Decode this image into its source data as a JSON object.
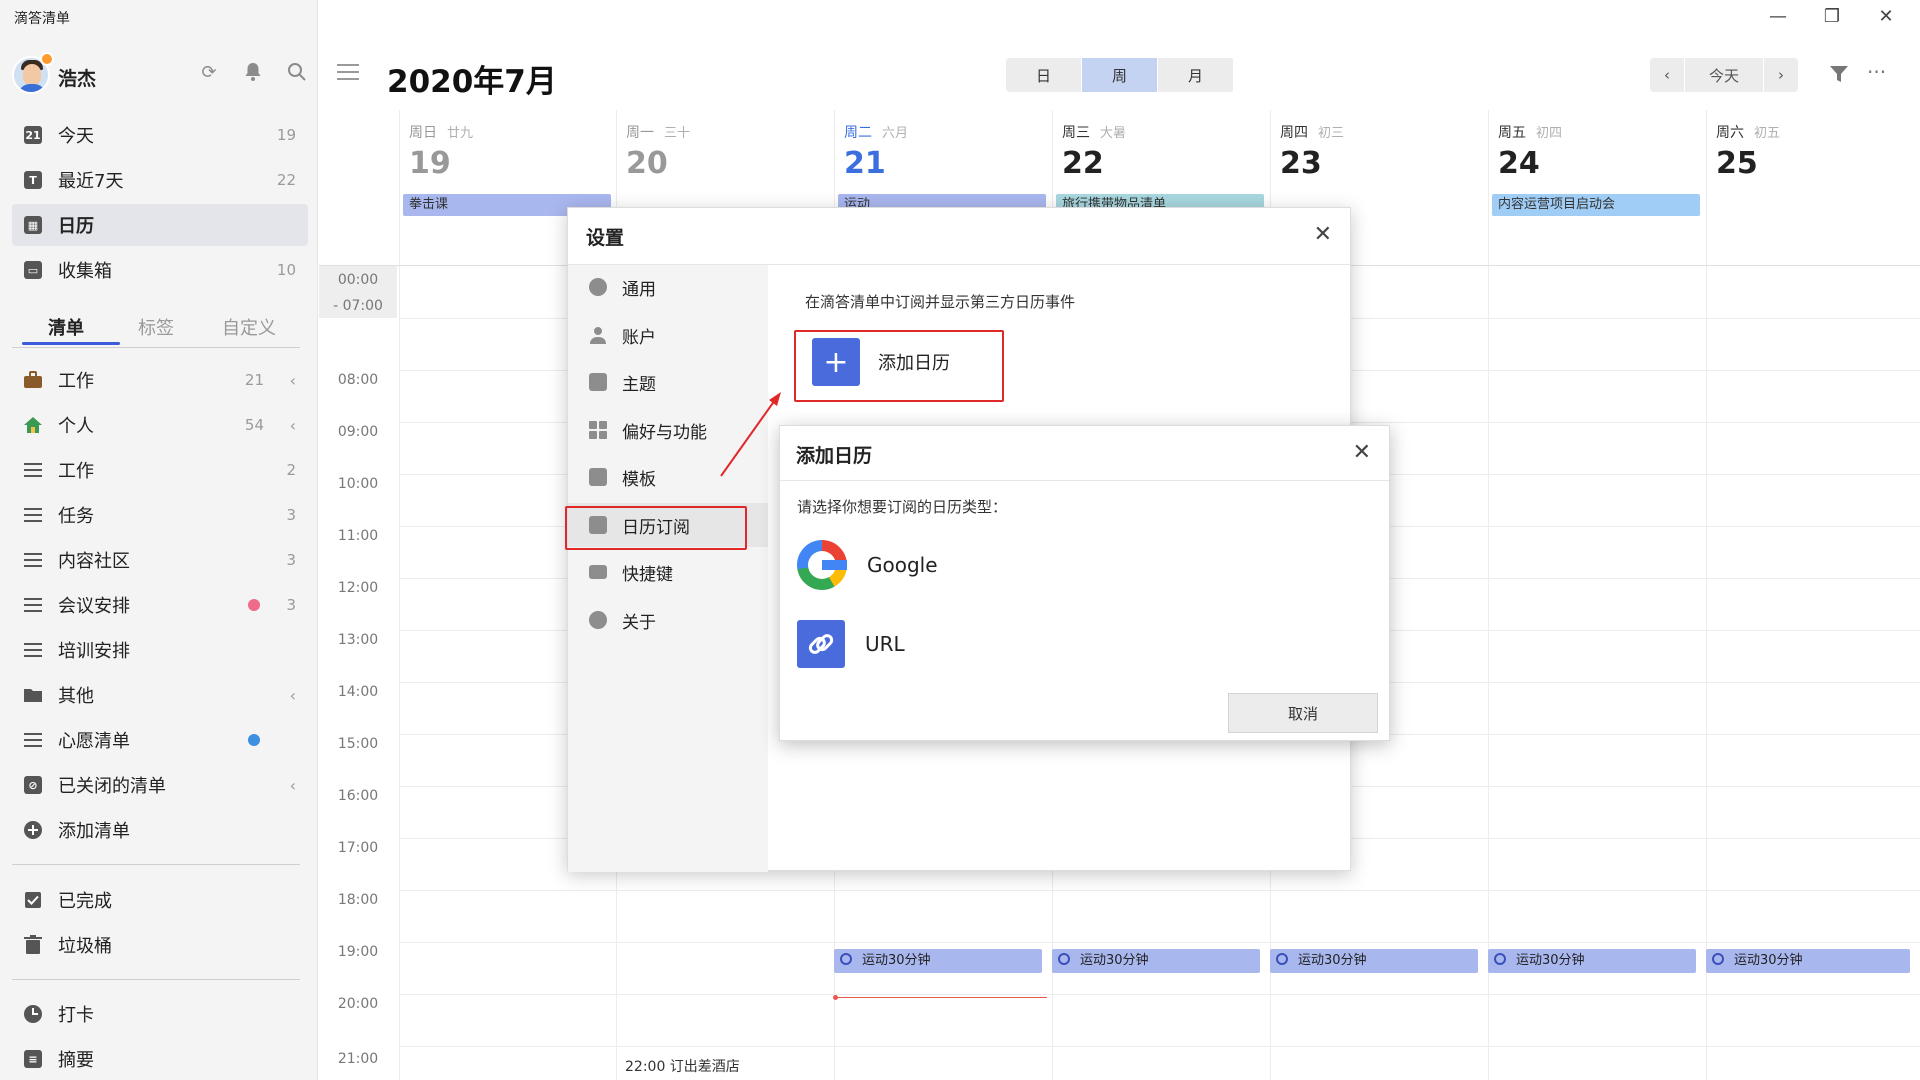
{
  "app": {
    "title": "滴答清单"
  },
  "user": {
    "name": "浩杰"
  },
  "sidebar": {
    "smart_lists": [
      {
        "label": "今天",
        "count": "19",
        "icon": "calendar-21-icon"
      },
      {
        "label": "最近7天",
        "count": "22",
        "icon": "calendar-week-icon"
      },
      {
        "label": "日历",
        "count": "",
        "icon": "calendar-grid-icon"
      },
      {
        "label": "收集箱",
        "count": "10",
        "icon": "inbox-icon"
      }
    ],
    "tabs": [
      "清单",
      "标签",
      "自定义"
    ],
    "lists": [
      {
        "label": "工作",
        "count": "21",
        "icon": "briefcase-icon",
        "chevron": true
      },
      {
        "label": "个人",
        "count": "54",
        "icon": "house-icon",
        "chevron": true
      },
      {
        "label": "工作",
        "count": "2",
        "icon": "list-icon"
      },
      {
        "label": "任务",
        "count": "3",
        "icon": "shared-list-icon"
      },
      {
        "label": "内容社区",
        "count": "3",
        "icon": "shared-list-icon"
      },
      {
        "label": "会议安排",
        "count": "3",
        "icon": "list-icon",
        "dot": "#f06b8a"
      },
      {
        "label": "培训安排",
        "count": "",
        "icon": "list-icon"
      },
      {
        "label": "其他",
        "count": "",
        "icon": "folder-icon",
        "chevron": true
      },
      {
        "label": "心愿清单",
        "count": "",
        "icon": "list-icon",
        "dot": "#3d8fe0"
      },
      {
        "label": "已关闭的清单",
        "count": "",
        "icon": "archive-icon",
        "chevron": true
      },
      {
        "label": "添加清单",
        "count": "",
        "icon": "plus-circle-icon"
      }
    ],
    "bottom": [
      {
        "label": "已完成",
        "icon": "checkbox-icon"
      },
      {
        "label": "垃圾桶",
        "icon": "trash-icon"
      },
      {
        "label": "打卡",
        "icon": "habit-icon"
      },
      {
        "label": "摘要",
        "icon": "summary-icon"
      }
    ]
  },
  "header": {
    "title": "2020年7月",
    "views": [
      "日",
      "周",
      "月"
    ],
    "active_view": "周",
    "today": "今天"
  },
  "days": [
    {
      "week": "周日",
      "lunar": "廿九",
      "num": "19",
      "event": "拳击课",
      "ev_color": "#a9b7ef"
    },
    {
      "week": "周一",
      "lunar": "三十",
      "num": "20",
      "event": "",
      "ev_color": ""
    },
    {
      "week": "周二",
      "lunar": "六月",
      "num": "21",
      "event": "运动",
      "ev_color": "#a9b7ef"
    },
    {
      "week": "周三",
      "lunar": "大暑",
      "num": "22",
      "event": "旅行携带物品清单",
      "ev_color": "#a7d7df"
    },
    {
      "week": "周四",
      "lunar": "初三",
      "num": "23",
      "event": "",
      "ev_color": ""
    },
    {
      "week": "周五",
      "lunar": "初四",
      "num": "24",
      "event": "内容运营项目启动会",
      "ev_color": "#9fcdf6"
    },
    {
      "week": "周六",
      "lunar": "初五",
      "num": "25",
      "event": "",
      "ev_color": ""
    }
  ],
  "times": [
    "00:00",
    "- 07:00",
    "08:00",
    "09:00",
    "10:00",
    "11:00",
    "12:00",
    "13:00",
    "14:00",
    "15:00",
    "16:00",
    "17:00",
    "18:00",
    "19:00",
    "20:00",
    "21:00"
  ],
  "timed_events": {
    "exercise": "运动30分钟",
    "hotel": "22:00 订出差酒店"
  },
  "settings": {
    "title": "设置",
    "items": [
      "通用",
      "账户",
      "主题",
      "偏好与功能",
      "模板",
      "日历订阅",
      "快捷键",
      "关于"
    ],
    "active": "日历订阅",
    "description": "在滴答清单中订阅并显示第三方日历事件",
    "add_button": "添加日历"
  },
  "add_calendar": {
    "title": "添加日历",
    "prompt": "请选择你想要订阅的日历类型：",
    "options": [
      "Google",
      "URL"
    ],
    "cancel": "取消"
  }
}
